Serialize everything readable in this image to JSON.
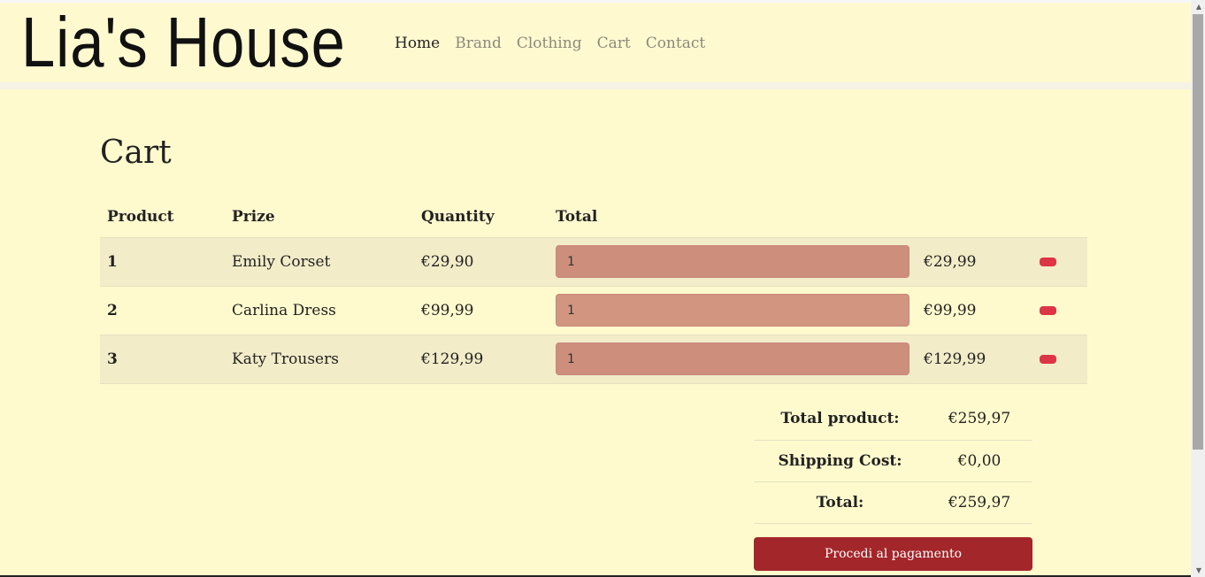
{
  "brand": {
    "logo": "Lia's House"
  },
  "nav": {
    "items": [
      {
        "label": "Home",
        "active": true
      },
      {
        "label": "Brand",
        "active": false
      },
      {
        "label": "Clothing",
        "active": false
      },
      {
        "label": "Cart",
        "active": false
      },
      {
        "label": "Contact",
        "active": false
      }
    ]
  },
  "page": {
    "title": "Cart"
  },
  "table": {
    "headers": [
      "Product",
      "Prize",
      "Quantity",
      "Total"
    ],
    "rows": [
      {
        "num": "1",
        "name": "Emily Corset",
        "price": "€29,90",
        "qty": "1",
        "total": "€29,99"
      },
      {
        "num": "2",
        "name": "Carlina Dress",
        "price": "€99,99",
        "qty": "1",
        "total": "€99,99"
      },
      {
        "num": "3",
        "name": "Katy Trousers",
        "price": "€129,99",
        "qty": "1",
        "total": "€129,99"
      }
    ]
  },
  "summary": {
    "product_label": "Total product:",
    "product_value": "€259,97",
    "shipping_label": "Shipping Cost:",
    "shipping_value": "€0,00",
    "total_label": "Total:",
    "total_value": "€259,97"
  },
  "checkout": {
    "button_label": "Procedi al pagamento"
  },
  "colors": {
    "background": "#fffacd",
    "pay_button": "#a3262a",
    "remove_button": "#dc3545",
    "qty_field": "#cd8f7c"
  }
}
